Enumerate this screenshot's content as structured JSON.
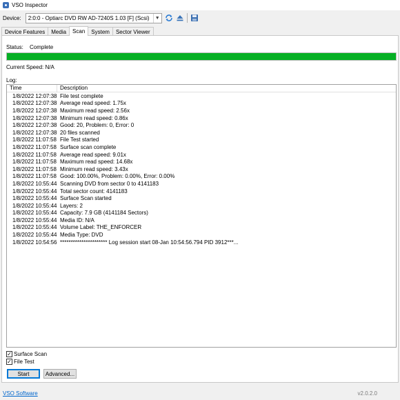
{
  "window": {
    "title": "VSO Inspector"
  },
  "device": {
    "label": "Device:",
    "selected": "2:0:0 - Optiarc DVD RW AD-7240S 1.03 [F] (Scsi)"
  },
  "toolbar": {
    "icons": [
      "refresh-icon",
      "eject-icon",
      "save-icon"
    ]
  },
  "tabs": [
    {
      "label": "Device Features",
      "active": false
    },
    {
      "label": "Media",
      "active": false
    },
    {
      "label": "Scan",
      "active": true
    },
    {
      "label": "System",
      "active": false
    },
    {
      "label": "Sector Viewer",
      "active": false
    }
  ],
  "scan": {
    "status_label": "Status:",
    "status_value": "Complete",
    "progress_fraction": 1.0,
    "progress_color": "#06b025",
    "current_speed": "Current Speed: N/A",
    "log_label": "Log:",
    "log_columns": {
      "time": "Time",
      "description": "Description"
    },
    "log": [
      {
        "time": "1/8/2022 12:07:38 PM",
        "desc": "File test complete"
      },
      {
        "time": "1/8/2022 12:07:38 PM",
        "desc": "Average read speed: 1.75x"
      },
      {
        "time": "1/8/2022 12:07:38 PM",
        "desc": "Maximum read speed: 2.56x"
      },
      {
        "time": "1/8/2022 12:07:38 PM",
        "desc": "Minimum read speed: 0.86x"
      },
      {
        "time": "1/8/2022 12:07:38 PM",
        "desc": "Good: 20, Problem: 0, Error: 0"
      },
      {
        "time": "1/8/2022 12:07:38 PM",
        "desc": "20 files scanned"
      },
      {
        "time": "1/8/2022 11:07:58 ...",
        "desc": "File Test started"
      },
      {
        "time": "1/8/2022 11:07:58 ...",
        "desc": "Surface scan complete"
      },
      {
        "time": "1/8/2022 11:07:58 ...",
        "desc": "Average read speed: 9.01x"
      },
      {
        "time": "1/8/2022 11:07:58 ...",
        "desc": "Maximum read speed: 14.68x"
      },
      {
        "time": "1/8/2022 11:07:58 ...",
        "desc": "Minimum read speed: 3.43x"
      },
      {
        "time": "1/8/2022 11:07:58 ...",
        "desc": "Good: 100.00%, Problem: 0.00%, Error: 0.00%"
      },
      {
        "time": "1/8/2022 10:55:44 ...",
        "desc": "Scanning DVD from sector 0 to 4141183"
      },
      {
        "time": "1/8/2022 10:55:44 ...",
        "desc": "Total sector count: 4141183"
      },
      {
        "time": "1/8/2022 10:55:44 ...",
        "desc": "Surface Scan started"
      },
      {
        "time": "1/8/2022 10:55:44 ...",
        "desc": "Layers: 2"
      },
      {
        "time": "1/8/2022 10:55:44 ...",
        "desc": "Capacity: 7.9 GB (4141184 Sectors)"
      },
      {
        "time": "1/8/2022 10:55:44 ...",
        "desc": "Media ID: N/A"
      },
      {
        "time": "1/8/2022 10:55:44 ...",
        "desc": "Volume Label: THE_ENFORCER"
      },
      {
        "time": "1/8/2022 10:55:44 ...",
        "desc": "Media Type: DVD"
      },
      {
        "time": "1/8/2022 10:54:56 ...",
        "desc": "********************** Log session start 08-Jan 10:54:56.794 PID 3912***..."
      }
    ],
    "surface_scan": {
      "label": "Surface Scan",
      "checked": true
    },
    "file_test": {
      "label": "File Test",
      "checked": true
    },
    "start_button": "Start",
    "advanced_button": "Advanced..."
  },
  "footer": {
    "link": "VSO Software",
    "version": "v2.0.2.0"
  }
}
